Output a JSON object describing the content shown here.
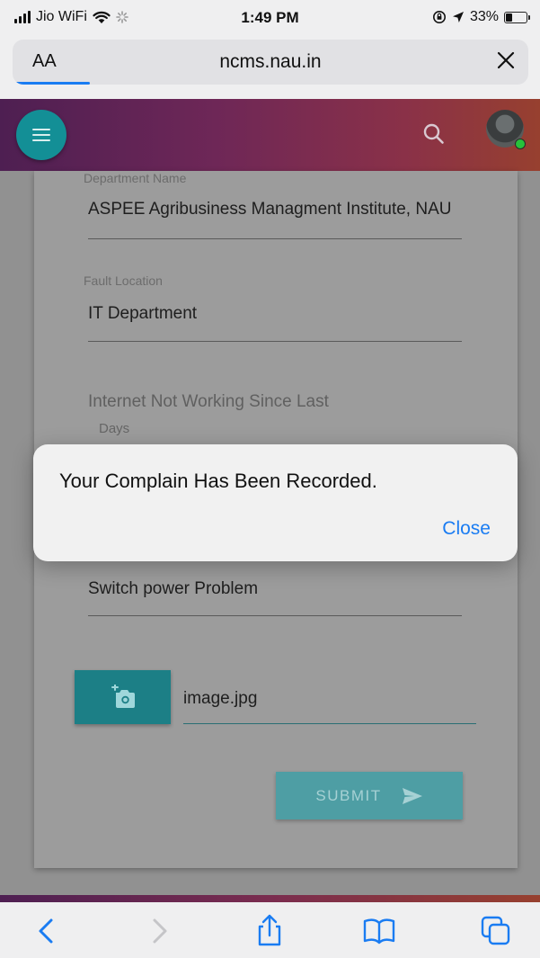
{
  "status_bar": {
    "carrier": "Jio WiFi",
    "time": "1:49 PM",
    "battery_text": "33%",
    "battery_level": 0.33
  },
  "browser": {
    "text_size_label": "AA",
    "url": "ncms.nau.in",
    "load_progress": 0.15
  },
  "form": {
    "department_label": "Department Name",
    "department_value": "ASPEE Agribusiness Managment Institute, NAU",
    "fault_location_label": "Fault Location",
    "fault_location_value": "IT Department",
    "internet_placeholder": "Internet Not Working Since Last",
    "internet_sub": "Days",
    "problem_value": "Switch power Problem",
    "file_name": "image.jpg",
    "submit_label": "SUBMIT"
  },
  "alert": {
    "message": "Your Complain Has Been Recorded.",
    "close_label": "Close"
  },
  "colors": {
    "accent_teal": "#138f96",
    "ios_blue": "#1a7cf2",
    "header_gradient_start": "#4e1f52",
    "header_gradient_end": "#97402f"
  },
  "icons": {
    "menu": "hamburger-icon",
    "search": "search-icon",
    "camera": "add-photo-icon",
    "send": "send-icon",
    "toolbar": [
      "back-icon",
      "forward-icon",
      "share-icon",
      "bookmarks-icon",
      "tabs-icon"
    ]
  }
}
